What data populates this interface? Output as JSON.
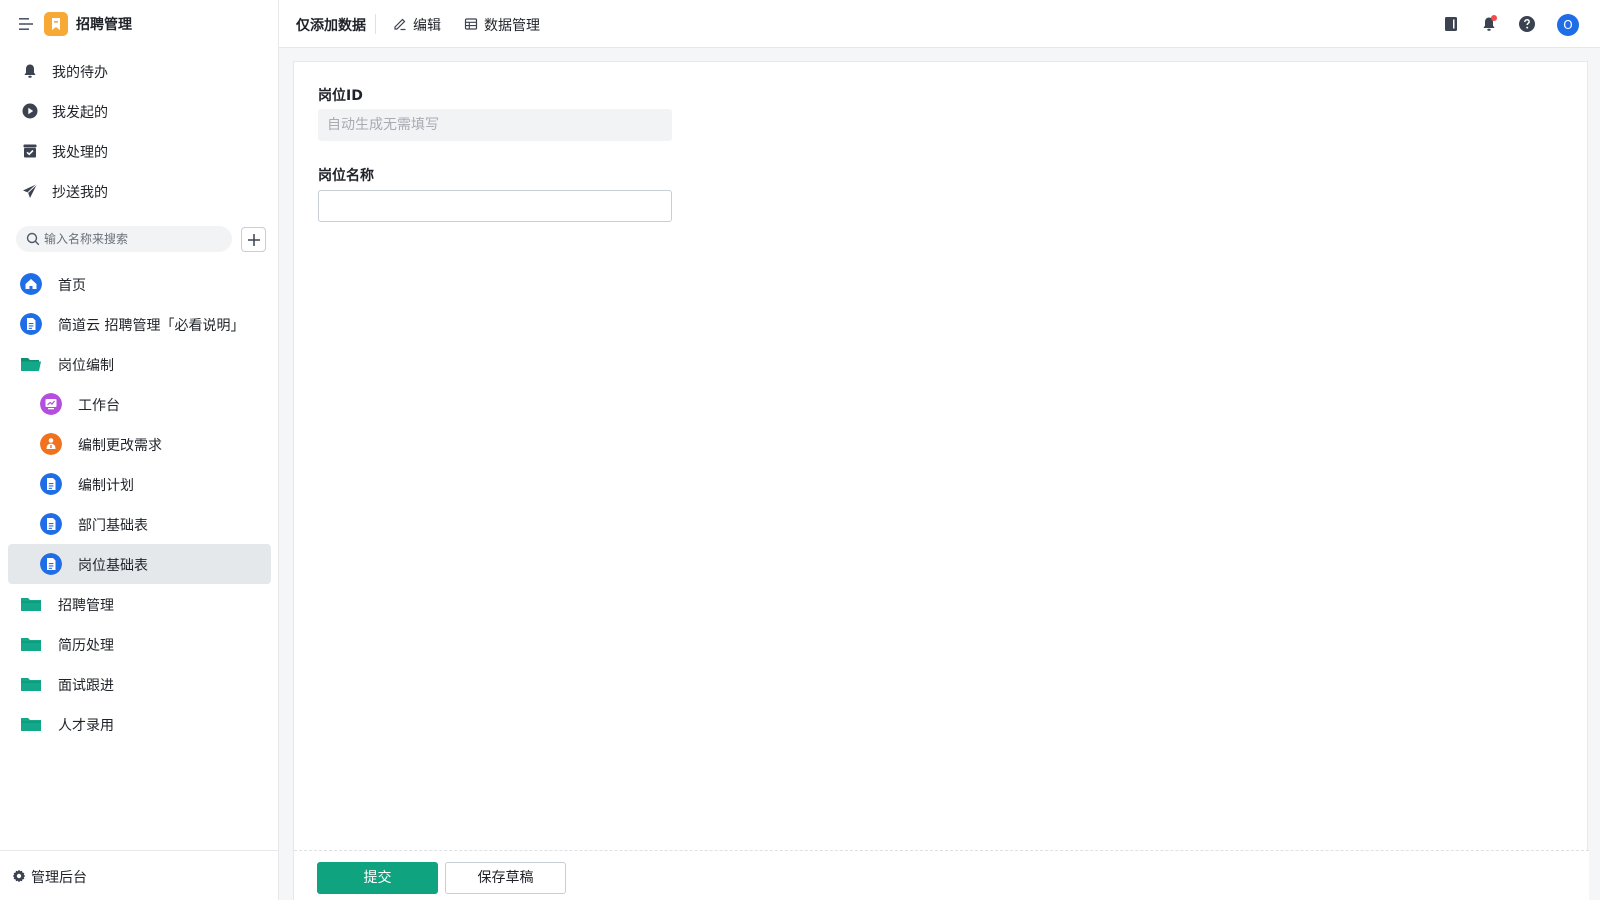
{
  "app": {
    "name": "招聘管理",
    "logo_icon": "bookmark-icon",
    "logo_color": "#f7a935"
  },
  "quick_nav": [
    {
      "label": "我的待办",
      "icon": "bell-icon"
    },
    {
      "label": "我发起的",
      "icon": "play-circle-icon"
    },
    {
      "label": "我处理的",
      "icon": "inbox-check-icon"
    },
    {
      "label": "抄送我的",
      "icon": "paper-plane-icon"
    }
  ],
  "search": {
    "placeholder": "输入名称来搜索"
  },
  "nav": [
    {
      "label": "首页",
      "icon": "home-icon",
      "level": 0,
      "color": "#1f6ee8"
    },
    {
      "label": "简道云 招聘管理「必看说明」",
      "icon": "document-icon",
      "level": 0,
      "color": "#1f6ee8"
    },
    {
      "label": "岗位编制",
      "icon": "folder-open-icon",
      "level": 0,
      "color": "#14a88a"
    },
    {
      "label": "工作台",
      "icon": "dashboard-icon",
      "level": 1,
      "color": "#b44ee0"
    },
    {
      "label": "编制更改需求",
      "icon": "person-flow-icon",
      "level": 1,
      "color": "#f0721f"
    },
    {
      "label": "编制计划",
      "icon": "document-icon",
      "level": 1,
      "color": "#1f6ee8"
    },
    {
      "label": "部门基础表",
      "icon": "document-icon",
      "level": 1,
      "color": "#1f6ee8"
    },
    {
      "label": "岗位基础表",
      "icon": "document-icon",
      "level": 1,
      "color": "#1f6ee8",
      "active": true
    },
    {
      "label": "招聘管理",
      "icon": "folder-icon",
      "level": 0,
      "color": "#14a88a"
    },
    {
      "label": "简历处理",
      "icon": "folder-icon",
      "level": 0,
      "color": "#14a88a"
    },
    {
      "label": "面试跟进",
      "icon": "folder-icon",
      "level": 0,
      "color": "#14a88a"
    },
    {
      "label": "人才录用",
      "icon": "folder-icon",
      "level": 0,
      "color": "#14a88a"
    }
  ],
  "footer": {
    "admin_label": "管理后台"
  },
  "topbar": {
    "title": "仅添加数据",
    "edit_label": "编辑",
    "data_manage_label": "数据管理",
    "right_icons": [
      "notebook-icon",
      "bell-icon",
      "help-icon"
    ],
    "avatar_text": "O",
    "avatar_color": "#1f6ee8"
  },
  "form": {
    "fields": [
      {
        "label": "岗位ID",
        "placeholder": "自动生成无需填写",
        "value": "",
        "disabled": true
      },
      {
        "label": "岗位名称",
        "placeholder": "",
        "value": "",
        "disabled": false
      }
    ],
    "submit_label": "提交",
    "draft_label": "保存草稿",
    "primary_color": "#10a37f"
  }
}
